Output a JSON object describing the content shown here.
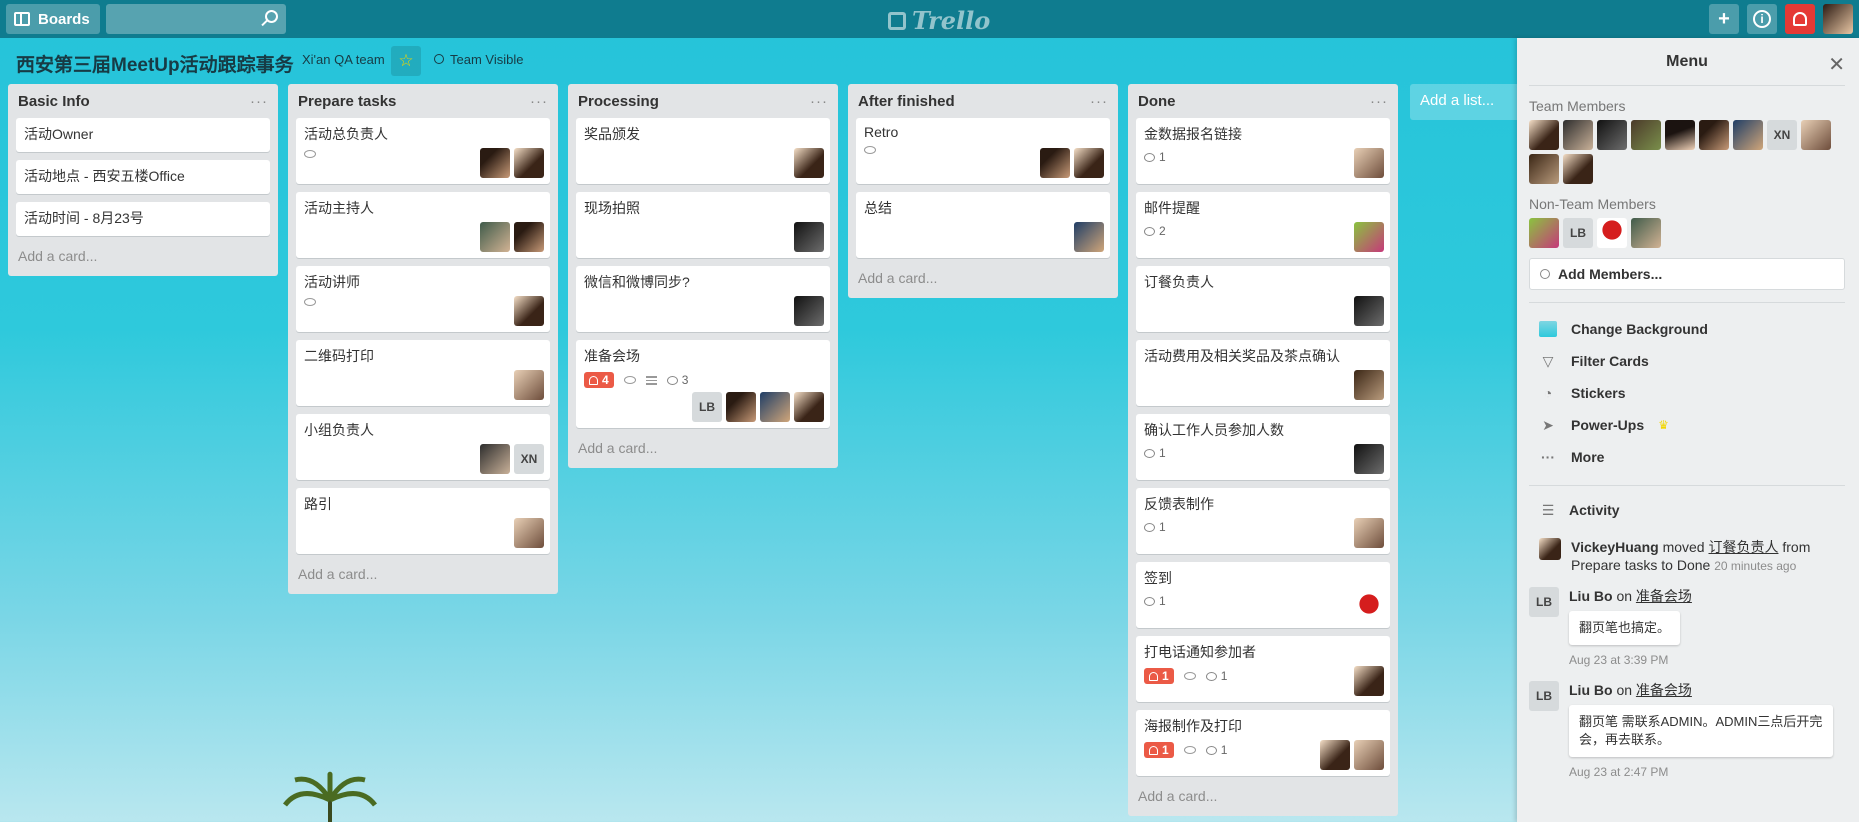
{
  "header": {
    "boards_label": "Boards",
    "search_placeholder": "",
    "logo_text": "Trello",
    "add_label": "+",
    "info_label": "i"
  },
  "board": {
    "title": "西安第三届MeetUp活动跟踪事务",
    "team": "Xi'an QA team",
    "visibility": "Team Visible",
    "add_list_label": "Add a list..."
  },
  "lists": [
    {
      "title": "Basic Info",
      "cards": [
        {
          "title": "活动Owner"
        },
        {
          "title": "活动地点 - 西安五楼Office"
        },
        {
          "title": "活动时间 - 8月23号"
        }
      ],
      "add_card": "Add a card..."
    },
    {
      "title": "Prepare tasks",
      "cards": [
        {
          "title": "活动总负责人"
        },
        {
          "title": "活动主持人"
        },
        {
          "title": "活动讲师"
        },
        {
          "title": "二维码打印"
        },
        {
          "title": "小组负责人",
          "member_text": "XN"
        },
        {
          "title": "路引"
        }
      ],
      "add_card": "Add a card..."
    },
    {
      "title": "Processing",
      "cards": [
        {
          "title": "奖品颁发"
        },
        {
          "title": "现场拍照"
        },
        {
          "title": "微信和微博同步?"
        },
        {
          "title": "准备会场",
          "due": "4",
          "comments": "3",
          "member_text": "LB"
        }
      ],
      "add_card": "Add a card..."
    },
    {
      "title": "After finished",
      "cards": [
        {
          "title": "Retro"
        },
        {
          "title": "总结"
        }
      ],
      "add_card": "Add a card..."
    },
    {
      "title": "Done",
      "cards": [
        {
          "title": "金数据报名链接",
          "comments": "1"
        },
        {
          "title": "邮件提醒",
          "comments": "2"
        },
        {
          "title": "订餐负责人"
        },
        {
          "title": "活动费用及相关奖品及茶点确认"
        },
        {
          "title": "确认工作人员参加人数",
          "comments": "1"
        },
        {
          "title": "反馈表制作",
          "comments": "1"
        },
        {
          "title": "签到",
          "comments": "1"
        },
        {
          "title": "打电话通知参加者",
          "due": "1",
          "comments": "1"
        },
        {
          "title": "海报制作及打印",
          "due": "1",
          "comments": "1"
        }
      ],
      "add_card": "Add a card..."
    }
  ],
  "sidebar": {
    "title": "Menu",
    "team_members_label": "Team Members",
    "team_member_text": "XN",
    "non_team_members_label": "Non-Team Members",
    "non_team_member_text": "LB",
    "add_members": "Add Members...",
    "menu": [
      {
        "label": "Change Background"
      },
      {
        "label": "Filter Cards"
      },
      {
        "label": "Stickers"
      },
      {
        "label": "Power-Ups"
      },
      {
        "label": "More"
      }
    ],
    "activity_label": "Activity",
    "activity": [
      {
        "user": "VickeyHuang",
        "text": "moved",
        "card": "订餐负责人",
        "tail": "from Prepare tasks to Done",
        "time": "20 minutes ago"
      },
      {
        "user": "Liu Bo",
        "on": "on",
        "card": "准备会场",
        "comment": "翻页笔也搞定。",
        "time": "Aug 23 at 3:39 PM",
        "initials": "LB"
      },
      {
        "user": "Liu Bo",
        "on": "on",
        "card": "准备会场",
        "comment": "翻页笔 需联系ADMIN。ADMIN三点后开完会，再去联系。",
        "time": "Aug 23 at 2:47 PM",
        "initials": "LB"
      }
    ]
  },
  "colors": {
    "header_bg": "#0f7c8f",
    "board_bg": "#25c3d9",
    "list_bg": "#e2e4e6",
    "due_red": "#eb5a46",
    "notification_red": "#e53935"
  }
}
